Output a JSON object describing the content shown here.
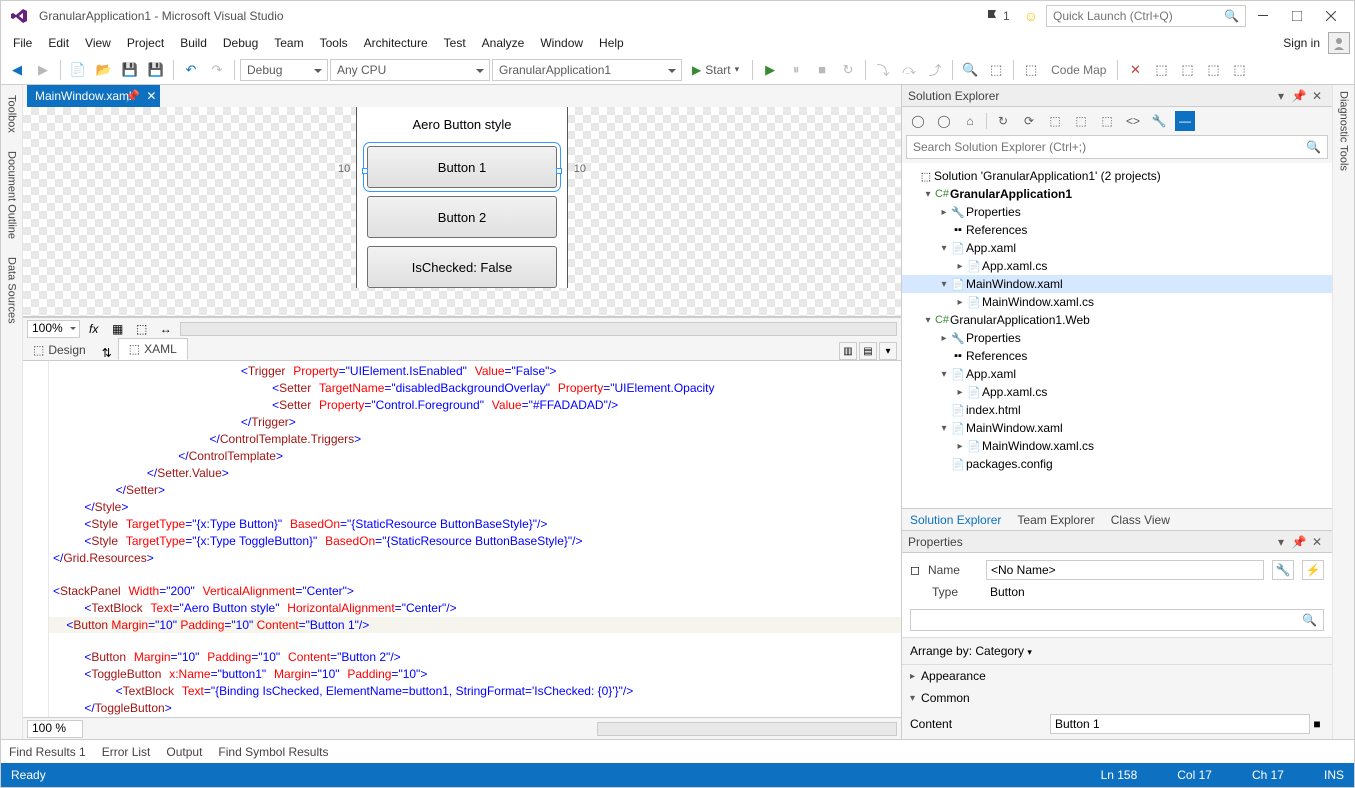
{
  "title": "GranularApplication1 - Microsoft Visual Studio",
  "flagCount": "1",
  "quickLaunchPlaceholder": "Quick Launch (Ctrl+Q)",
  "signIn": "Sign in",
  "menu": [
    "File",
    "Edit",
    "View",
    "Project",
    "Build",
    "Debug",
    "Team",
    "Tools",
    "Architecture",
    "Test",
    "Analyze",
    "Window",
    "Help"
  ],
  "toolbar": {
    "config": "Debug",
    "platform": "Any CPU",
    "startupProject": "GranularApplication1",
    "start": "Start",
    "codeMap": "Code Map"
  },
  "sideLeft": [
    "Toolbox",
    "Document Outline",
    "Data Sources"
  ],
  "sideRight": [
    "Diagnostic Tools"
  ],
  "docTab": "MainWindow.xaml*",
  "designer": {
    "heading": "Aero Button style",
    "btn1": "Button 1",
    "btn2": "Button 2",
    "btn3": "IsChecked: False",
    "marginLeft": "10",
    "marginRight": "10",
    "zoom": "100%"
  },
  "paneTabs": {
    "design": "Design",
    "xaml": "XAML"
  },
  "code": {
    "zoom": "100 %"
  },
  "bottomTabs": [
    "Find Results 1",
    "Error List",
    "Output",
    "Find Symbol Results"
  ],
  "solutionExplorer": {
    "title": "Solution Explorer",
    "searchPlaceholder": "Search Solution Explorer (Ctrl+;)",
    "solution": "Solution 'GranularApplication1' (2 projects)",
    "proj1": "GranularApplication1",
    "proj2": "GranularApplication1.Web",
    "properties": "Properties",
    "references": "References",
    "appxaml": "App.xaml",
    "appxamlcs": "App.xaml.cs",
    "mainxaml": "MainWindow.xaml",
    "mainxamlcs": "MainWindow.xaml.cs",
    "indexhtml": "index.html",
    "packages": "packages.config",
    "tabs": [
      "Solution Explorer",
      "Team Explorer",
      "Class View"
    ]
  },
  "properties": {
    "title": "Properties",
    "nameLabel": "Name",
    "nameValue": "<No Name>",
    "typeLabel": "Type",
    "typeValue": "Button",
    "arrange": "Arrange by: Category",
    "catAppearance": "Appearance",
    "catCommon": "Common",
    "contentLabel": "Content",
    "contentValue": "Button 1"
  },
  "status": {
    "ready": "Ready",
    "ln": "Ln 158",
    "col": "Col 17",
    "ch": "Ch 17",
    "ins": "INS"
  }
}
